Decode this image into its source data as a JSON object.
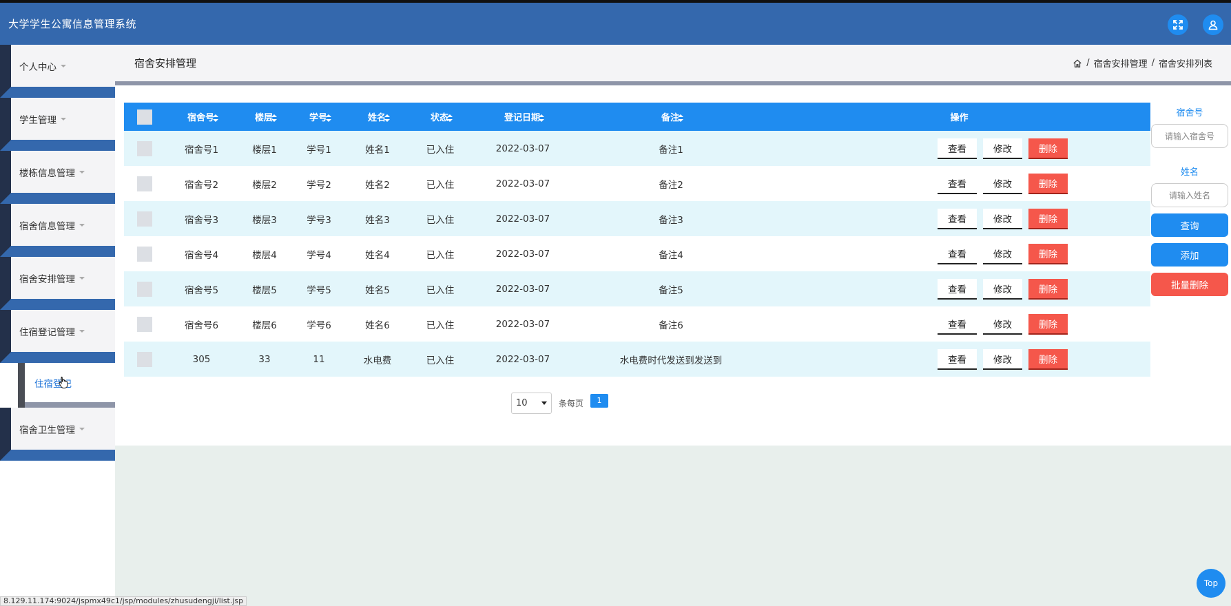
{
  "app": {
    "title": "大学学生公寓信息管理系统"
  },
  "header": {
    "fullscreen_icon": "expand-icon",
    "user_icon": "user-icon"
  },
  "sidebar": {
    "items": [
      {
        "label": "个人中心"
      },
      {
        "label": "学生管理"
      },
      {
        "label": "楼栋信息管理"
      },
      {
        "label": "宿舍信息管理"
      },
      {
        "label": "宿舍安排管理"
      },
      {
        "label": "住宿登记管理"
      },
      {
        "label": "宿舍卫生管理"
      }
    ],
    "submenu": {
      "label": "住宿登记"
    }
  },
  "page": {
    "title": "宿舍安排管理",
    "breadcrumb": {
      "sep": "/",
      "level1": "宿舍安排管理",
      "level2": "宿舍安排列表"
    }
  },
  "table": {
    "headers": [
      "宿舍号",
      "楼层",
      "学号",
      "姓名",
      "状态",
      "登记日期",
      "备注",
      "操作"
    ],
    "rows": [
      {
        "dorm": "宿舍号1",
        "floor": "楼层1",
        "sid": "学号1",
        "name": "姓名1",
        "status": "已入住",
        "date": "2022-03-07",
        "note": "备注1"
      },
      {
        "dorm": "宿舍号2",
        "floor": "楼层2",
        "sid": "学号2",
        "name": "姓名2",
        "status": "已入住",
        "date": "2022-03-07",
        "note": "备注2"
      },
      {
        "dorm": "宿舍号3",
        "floor": "楼层3",
        "sid": "学号3",
        "name": "姓名3",
        "status": "已入住",
        "date": "2022-03-07",
        "note": "备注3"
      },
      {
        "dorm": "宿舍号4",
        "floor": "楼层4",
        "sid": "学号4",
        "name": "姓名4",
        "status": "已入住",
        "date": "2022-03-07",
        "note": "备注4"
      },
      {
        "dorm": "宿舍号5",
        "floor": "楼层5",
        "sid": "学号5",
        "name": "姓名5",
        "status": "已入住",
        "date": "2022-03-07",
        "note": "备注5"
      },
      {
        "dorm": "宿舍号6",
        "floor": "楼层6",
        "sid": "学号6",
        "name": "姓名6",
        "status": "已入住",
        "date": "2022-03-07",
        "note": "备注6"
      },
      {
        "dorm": "305",
        "floor": "33",
        "sid": "11",
        "name": "水电费",
        "status": "已入住",
        "date": "2022-03-07",
        "note": "水电费时代发送到发送到"
      }
    ],
    "actions": {
      "view": "查看",
      "edit": "修改",
      "delete": "删除"
    }
  },
  "pagination": {
    "page_size": "10",
    "per_page_label": "条每页",
    "current_page": "1"
  },
  "search": {
    "dorm_label": "宿舍号",
    "dorm_placeholder": "请输入宿舍号",
    "name_label": "姓名",
    "name_placeholder": "请输入姓名",
    "query_button": "查询",
    "add_button": "添加",
    "batch_delete_button": "批量删除"
  },
  "footer": {
    "status_url": "8.129.11.174:9024/jspmx49c1/jsp/modules/zhusudengji/list.jsp",
    "top_button": "Top"
  },
  "colors": {
    "header": "#3468ad",
    "accent": "#1f8cf0",
    "danger": "#f5574b",
    "row_alt": "#e3f6fb"
  }
}
